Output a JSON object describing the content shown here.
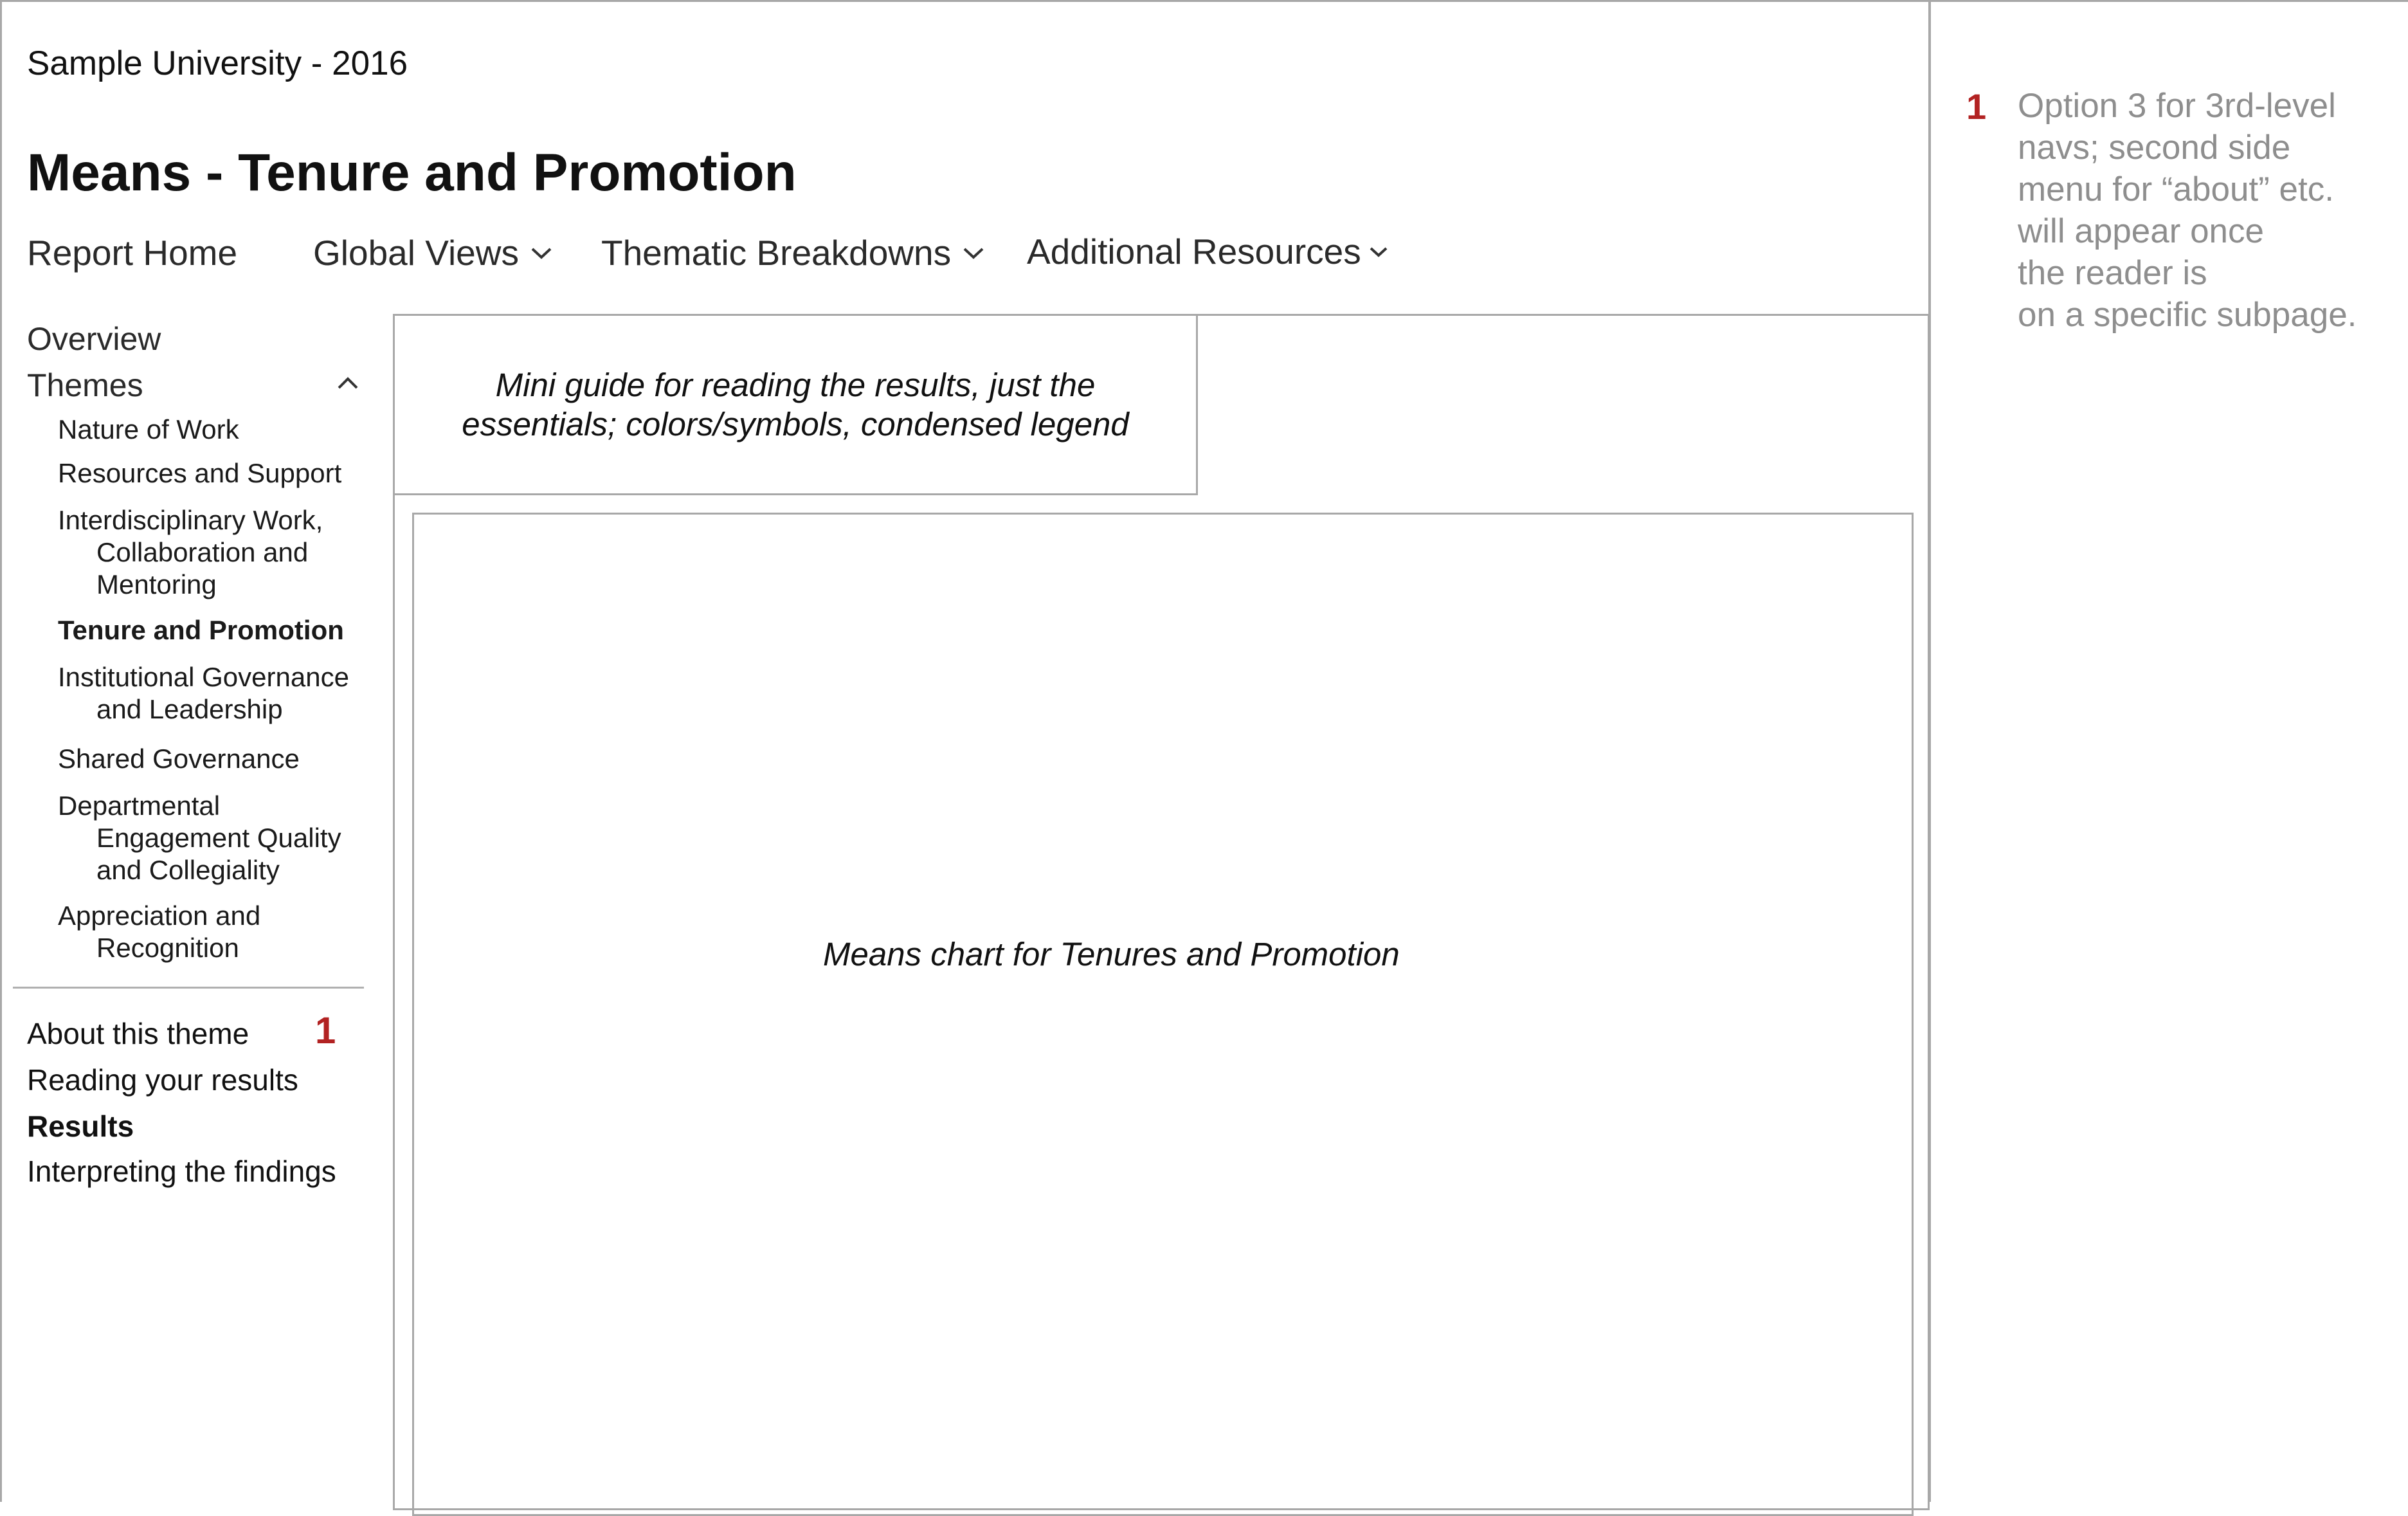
{
  "header": {
    "university": "Sample University - 2016",
    "page_title": "Means - Tenure and Promotion"
  },
  "top_nav": {
    "report_home": "Report Home",
    "global_views": "Global Views",
    "thematic_breakdowns": "Thematic Breakdowns",
    "additional_resources": "Additional Resources"
  },
  "sidebar": {
    "overview": "Overview",
    "themes": "Themes",
    "theme_items": [
      {
        "line1": "Nature of Work"
      },
      {
        "line1": "Resources and Support"
      },
      {
        "line1": "Interdisciplinary Work,",
        "line2": "Collaboration and",
        "line3": "Mentoring"
      },
      {
        "line1": "Tenure and Promotion",
        "active": true
      },
      {
        "line1": "Institutional Governance",
        "line2": "and Leadership"
      },
      {
        "line1": "Shared Governance"
      },
      {
        "line1": "Departmental",
        "line2": "Engagement Quality",
        "line3": "and Collegiality"
      },
      {
        "line1": "Appreciation and",
        "line2": "Recognition"
      }
    ],
    "sub_nav": {
      "about": "About this theme",
      "reading": "Reading your results",
      "results": "Results",
      "interpreting": "Interpreting the findings"
    },
    "marker": "1"
  },
  "main": {
    "mini_guide": "Mini guide for reading the results, just the essentials; colors/symbols, condensed legend",
    "chart_placeholder": "Means chart for Tenures and Promotion"
  },
  "annotation": {
    "number": "1",
    "lines": [
      "Option 3 for 3rd-level",
      "navs; second side",
      "menu for “about” etc.",
      "will appear once",
      "the reader is",
      "on a specific subpage."
    ]
  },
  "colors": {
    "accent": "#b22222",
    "border": "#a8a8a8",
    "note_text": "#8e8e8e"
  },
  "icons": [
    "chevron-down-icon",
    "chevron-up-icon"
  ]
}
